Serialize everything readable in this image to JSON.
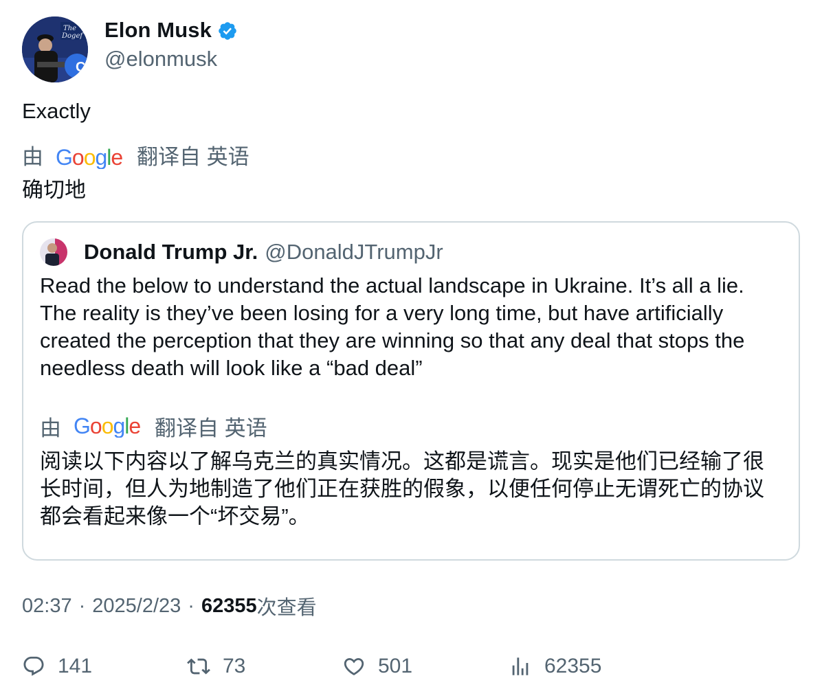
{
  "author": {
    "display_name": "Elon Musk",
    "handle": "@elonmusk",
    "verified": true,
    "avatar_text": "The Dogefather"
  },
  "tweet": {
    "text": "Exactly",
    "translation": {
      "by_label": "由",
      "provider": "Google",
      "from_label": "翻译自 英语",
      "text": "确切地"
    }
  },
  "quoted": {
    "display_name": "Donald Trump Jr.",
    "handle": "@DonaldJTrumpJr",
    "text": "Read the below to understand the actual landscape in Ukraine. It’s all a lie. The reality is they’ve been losing for a very long time, but have artificially created the perception that they are winning so that any deal that stops the needless death will look like a “bad deal”",
    "translation": {
      "by_label": "由",
      "provider": "Google",
      "from_label": "翻译自 英语",
      "text": "阅读以下内容以了解乌克兰的真实情况。这都是谎言。现实是他们已经输了很长时间，但人为地制造了他们正在获胜的假象，以便任何停止无谓死亡的协议都会看起来像一个“坏交易”。"
    }
  },
  "meta": {
    "time": "02:37",
    "separator": "·",
    "date": "2025/2/23",
    "views_count": "62355",
    "views_label": "次查看"
  },
  "actions": {
    "replies": "141",
    "retweets": "73",
    "likes": "501",
    "views": "62355"
  },
  "colors": {
    "primary_text": "#0f1419",
    "secondary_text": "#536471",
    "border": "#cfd9de",
    "verified_blue": "#1d9bf0"
  }
}
